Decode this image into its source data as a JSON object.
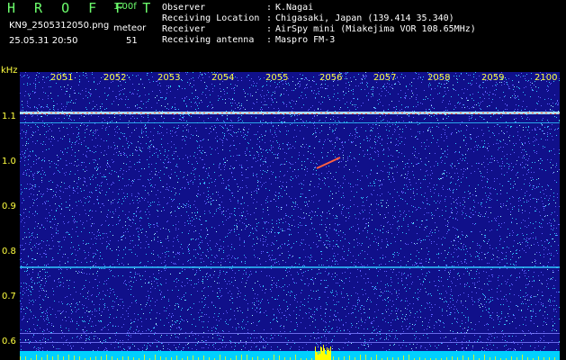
{
  "header": {
    "brand": "H R O F F T",
    "version": "1.00f",
    "filename": "KN9_2505312050.png",
    "mode": "meteor",
    "datetime": "25.05.31 20:50",
    "count": "51"
  },
  "station_info": [
    {
      "label": "Observer",
      "value": "K.Nagai"
    },
    {
      "label": "Receiving Location",
      "value": "Chigasaki, Japan (139.414 35.340)"
    },
    {
      "label": "Receiver",
      "value": "AirSpy mini (Miakejima VOR 108.65MHz)"
    },
    {
      "label": "Receiving antenna",
      "value": "Maspro FM-3"
    }
  ],
  "spectrogram": {
    "y_unit": "kHz",
    "x_ticks": [
      "2051",
      "2052",
      "2053",
      "2054",
      "2055",
      "2056",
      "2057",
      "2058",
      "2059",
      "2100"
    ],
    "y_ticks": [
      "1.1",
      "1.0",
      "0.9",
      "0.8",
      "0.7",
      "0.6"
    ],
    "colors": {
      "background": "#10108a",
      "noise_cyan": "#30c8ff",
      "noise_light": "#6060ff",
      "carrier": "#c8ffff",
      "meteor": "#ff6040",
      "baseline": "#00d0ff",
      "burst": "#ffff00"
    }
  }
}
